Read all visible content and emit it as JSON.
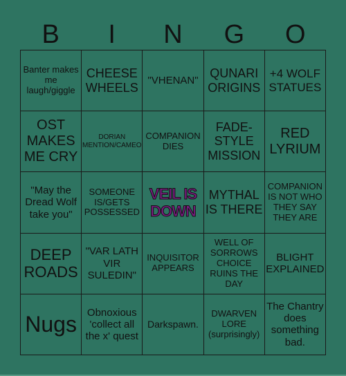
{
  "header": {
    "letters": [
      "B",
      "I",
      "N",
      "G",
      "O"
    ]
  },
  "free_space_color": "#7a1a80",
  "background_color": "#2e7461",
  "cells": [
    [
      "Banter makes me laugh/giggle",
      "CHEESE WHEELS",
      "\"VHENAN\"",
      "QUNARI ORIGINS",
      "+4 WOLF STATUES"
    ],
    [
      "OST MAKES ME CRY",
      "DORIAN MENTION/CAMEO",
      "COMPANION DIES",
      "FADE-STYLE MISSION",
      "RED LYRIUM"
    ],
    [
      "\"May the Dread Wolf take you\"",
      "SOMEONE IS/GETS POSSESSED",
      "VEIL IS DOWN",
      "MYTHAL IS THERE",
      "COMPANION IS NOT WHO THEY SAY THEY ARE"
    ],
    [
      "DEEP ROADS",
      "\"VAR LATH VIR SULEDIN\"",
      "INQUISITOR APPEARS",
      "WELL OF SORROWS CHOICE RUINS THE DAY",
      "BLIGHT EXPLAINED"
    ],
    [
      "Nugs",
      "Obnoxious 'collect all the x' quest",
      "Darkspawn.",
      "DWARVEN LORE (surprisingly)",
      "The Chantry does something bad."
    ]
  ]
}
